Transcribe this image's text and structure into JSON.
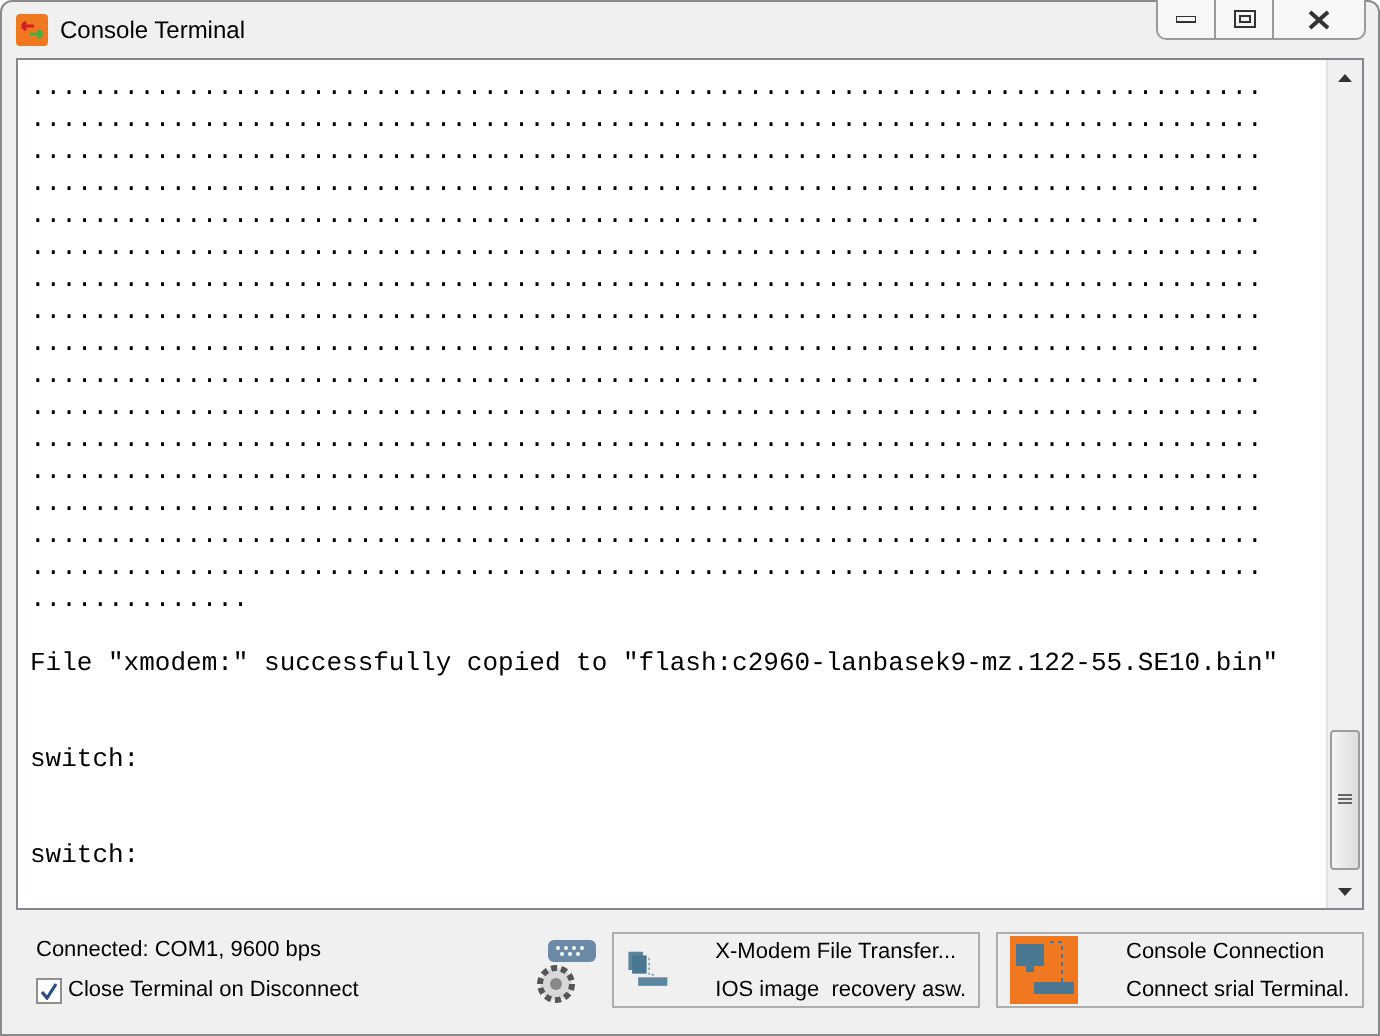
{
  "window": {
    "title": "Console Terminal"
  },
  "terminal": {
    "lines": [
      {
        "kind": "output",
        "text": "..............................................................................."
      },
      {
        "kind": "output",
        "text": "..............................................................................."
      },
      {
        "kind": "output",
        "text": "..............................................................................."
      },
      {
        "kind": "output",
        "text": "..............................................................................."
      },
      {
        "kind": "output",
        "text": "..............................................................................."
      },
      {
        "kind": "output",
        "text": "..............................................................................."
      },
      {
        "kind": "output",
        "text": "..............................................................................."
      },
      {
        "kind": "output",
        "text": "..............................................................................."
      },
      {
        "kind": "output",
        "text": "..............................................................................."
      },
      {
        "kind": "output",
        "text": "..............................................................................."
      },
      {
        "kind": "output",
        "text": "..............................................................................."
      },
      {
        "kind": "output",
        "text": "..............................................................................."
      },
      {
        "kind": "output",
        "text": "..............................................................................."
      },
      {
        "kind": "output",
        "text": "..............................................................................."
      },
      {
        "kind": "output",
        "text": "..............................................................................."
      },
      {
        "kind": "output",
        "text": "..............................................................................."
      },
      {
        "kind": "output",
        "text": ".............."
      },
      {
        "kind": "message",
        "text": "File \"xmodem:\" successfully copied to \"flash:c2960-lanbasek9-mz.122-55.SE10.bin\""
      },
      {
        "kind": "prompt",
        "text": "switch:"
      },
      {
        "kind": "prompt",
        "text": "switch:"
      }
    ]
  },
  "status": {
    "connection": "Connected: COM1, 9600 bps",
    "close_on_disconnect": {
      "label": "Close Terminal on Disconnect",
      "checked": true
    }
  },
  "actions": [
    {
      "kind": "xmodem",
      "title": "X-Modem File Transfer...",
      "subtitle": "IOS image  recovery asw."
    },
    {
      "kind": "console",
      "title": "Console Connection",
      "subtitle": "Connect srial Terminal."
    }
  ]
}
